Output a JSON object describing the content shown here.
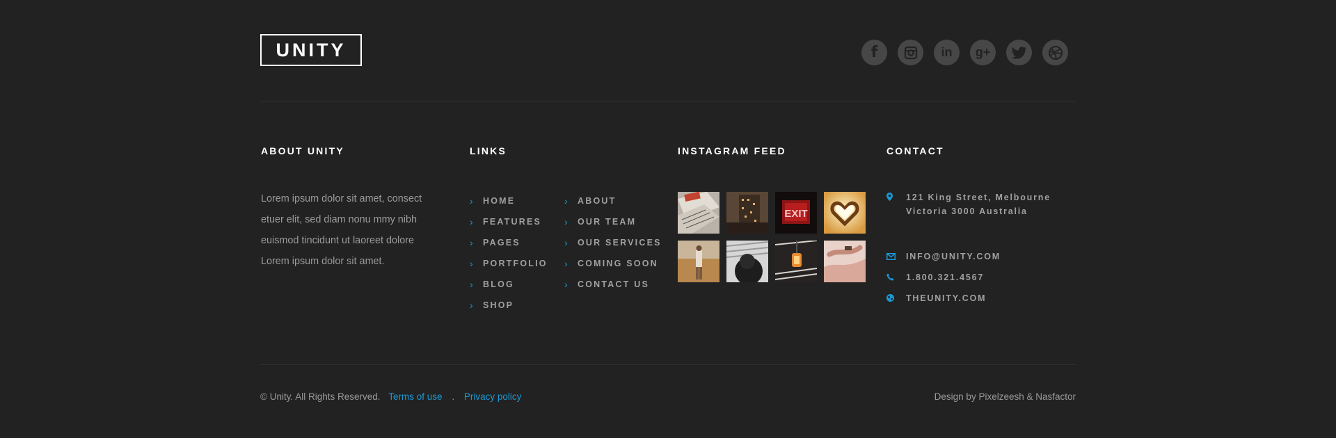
{
  "brand": {
    "logo_text": "UNITY"
  },
  "socials": [
    {
      "icon": "facebook-icon",
      "glyph": "f"
    },
    {
      "icon": "instagram-icon",
      "glyph": ""
    },
    {
      "icon": "linkedin-icon",
      "glyph": "in"
    },
    {
      "icon": "google-plus-icon",
      "glyph": "g+"
    },
    {
      "icon": "twitter-icon",
      "glyph": ""
    },
    {
      "icon": "dribbble-icon",
      "glyph": ""
    }
  ],
  "about": {
    "heading": "ABOUT UNITY",
    "text": "Lorem ipsum dolor sit amet, consect etuer elit, sed diam nonu mmy nibh euismod tincidunt ut laoreet dolore Lorem ipsum dolor sit amet."
  },
  "links": {
    "heading": "LINKS",
    "col1": [
      "HOME",
      "FEATURES",
      "PAGES",
      "PORTFOLIO",
      "BLOG",
      "SHOP"
    ],
    "col2": [
      "ABOUT",
      "OUR TEAM",
      "OUR SERVICES",
      "COMING SOON",
      "CONTACT US"
    ]
  },
  "instagram": {
    "heading": "INSTAGRAM FEED",
    "exit_sign": "EXIT"
  },
  "contact": {
    "heading": "CONTACT",
    "address_line1": "121 King Street, Melbourne",
    "address_line2": "Victoria 3000 Australia",
    "email": "INFO@UNITY.COM",
    "phone": "1.800.321.4567",
    "website": "THEUNITY.COM"
  },
  "footer": {
    "copyright": "© Unity. All Rights Reserved.",
    "terms": "Terms of use",
    "separator": ".",
    "privacy": "Privacy policy",
    "credit": "Design by Pixelzeesh & Nasfactor"
  },
  "colors": {
    "background": "#222222",
    "accent": "#1b9ad6",
    "social_bg": "#474747"
  }
}
